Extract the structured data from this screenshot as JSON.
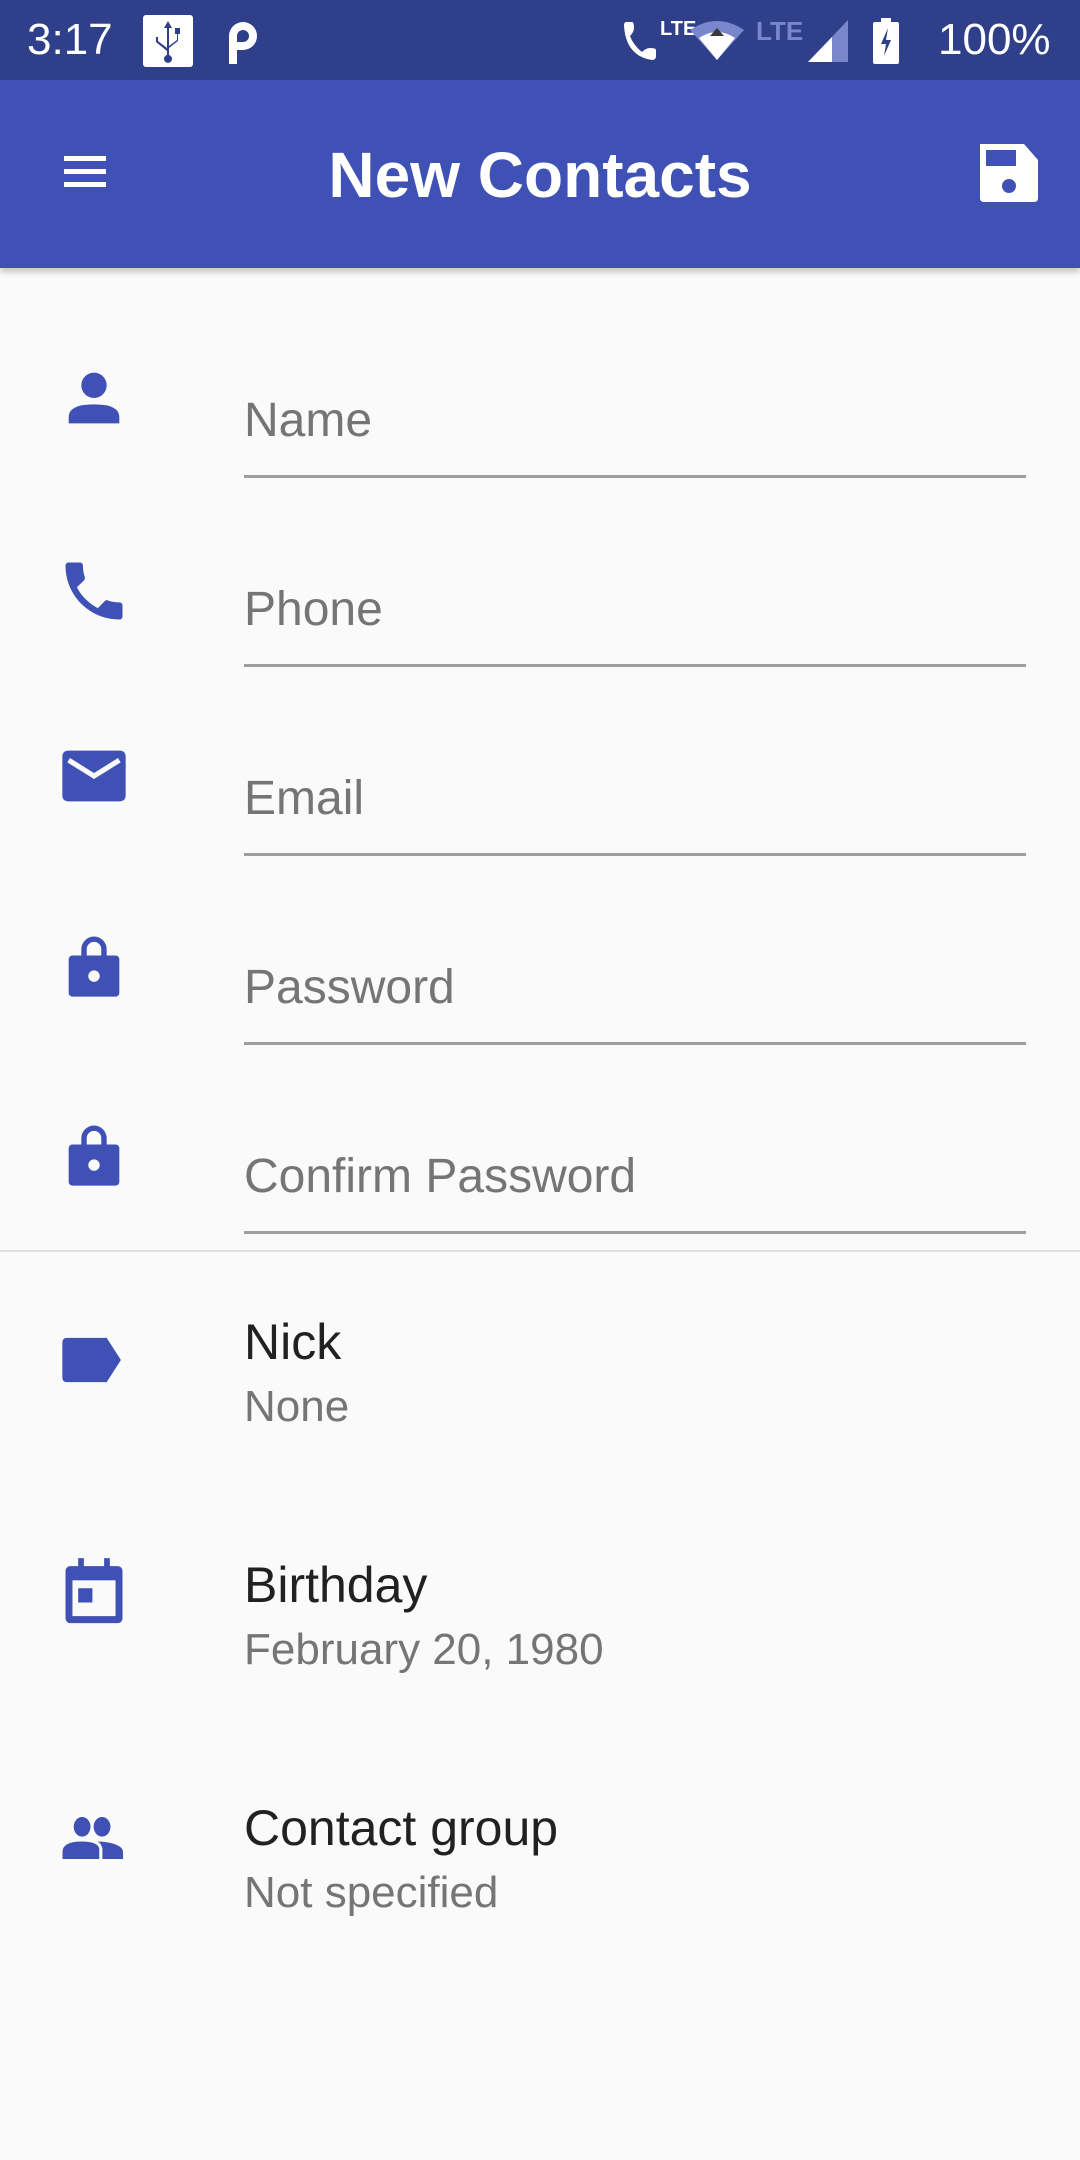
{
  "status_bar": {
    "time": "3:17",
    "battery_percent": "100%",
    "icons": [
      "usb-icon",
      "parking-icon",
      "volte-call-icon",
      "wifi-icon",
      "lte-icon",
      "signal-icon",
      "battery-charging-icon"
    ],
    "volte_label": "LTE",
    "lte_label": "LTE"
  },
  "app_bar": {
    "title": "New Contacts",
    "menu_icon": "menu-icon",
    "save_icon": "save-icon",
    "background": "#3f51b5"
  },
  "form": {
    "fields": [
      {
        "icon": "person-icon",
        "placeholder": "Name",
        "value": ""
      },
      {
        "icon": "phone-icon",
        "placeholder": "Phone",
        "value": ""
      },
      {
        "icon": "email-icon",
        "placeholder": "Email",
        "value": ""
      },
      {
        "icon": "lock-icon",
        "placeholder": "Password",
        "value": ""
      },
      {
        "icon": "lock-icon",
        "placeholder": "Confirm Password",
        "value": ""
      }
    ]
  },
  "details": [
    {
      "icon": "label-icon",
      "title": "Nick",
      "value": "None"
    },
    {
      "icon": "calendar-icon",
      "title": "Birthday",
      "value": "February 20, 1980"
    },
    {
      "icon": "group-icon",
      "title": "Contact group",
      "value": "Not specified"
    }
  ],
  "colors": {
    "primary": "#3f51b5",
    "primary_dark": "#303f8a",
    "background": "#fafafa",
    "text_primary": "#212121",
    "text_secondary": "#757575"
  }
}
